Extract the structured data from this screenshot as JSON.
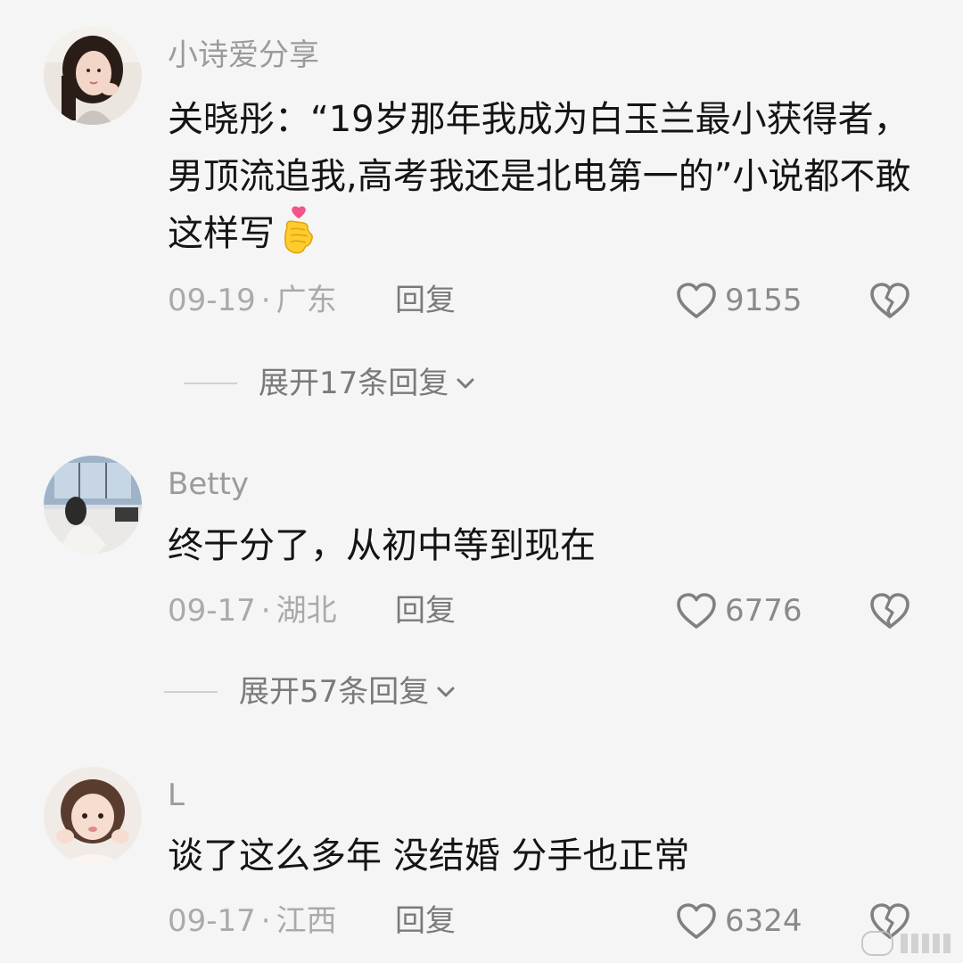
{
  "comments": [
    {
      "username": "小诗爱分享",
      "content": "关晓彤：“19岁那年我成为白玉兰最小获得者，男顶流追我,高考我还是北电第一的”小说都不敢这样写",
      "emoji": "finger-heart",
      "date": "09-19",
      "location": "广东",
      "separator": "·",
      "reply_label": "回复",
      "likes": "9155",
      "expand_label": "展开17条回复"
    },
    {
      "username": "Betty",
      "content": "终于分了，从初中等到现在",
      "date": "09-17",
      "location": "湖北",
      "separator": "·",
      "reply_label": "回复",
      "likes": "6776",
      "expand_label": "展开57条回复"
    },
    {
      "username": "L",
      "content": "谈了这么多年 没结婚 分手也正常",
      "date": "09-17",
      "location": "江西",
      "separator": "·",
      "reply_label": "回复",
      "likes": "6324"
    }
  ],
  "icons": {
    "like": "heart-outline-icon",
    "dislike": "broken-heart-icon",
    "expand": "chevron-down-icon"
  },
  "colors": {
    "background": "#f5f5f5",
    "username": "#9b9b9b",
    "content": "#141414",
    "meta": "#aaaaaa"
  }
}
